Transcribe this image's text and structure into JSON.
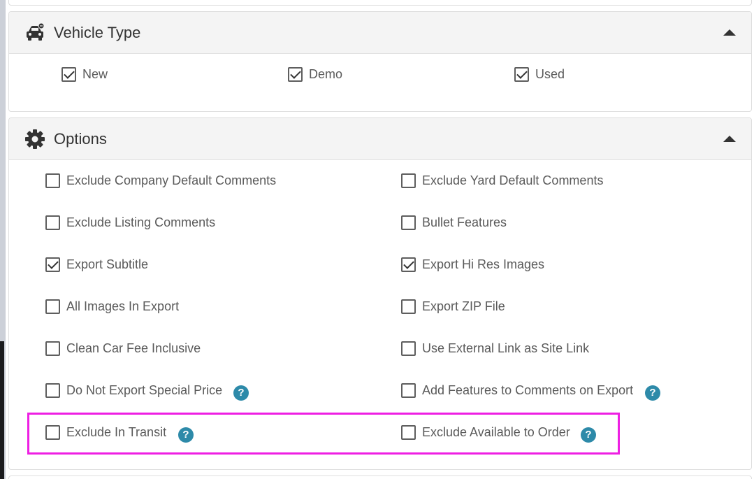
{
  "vehicle_type": {
    "title": "Vehicle Type",
    "icon": "car-icon",
    "items": [
      {
        "label": "New",
        "checked": true
      },
      {
        "label": "Demo",
        "checked": true
      },
      {
        "label": "Used",
        "checked": true
      }
    ]
  },
  "options": {
    "title": "Options",
    "icon": "gear-icon",
    "items": [
      {
        "label": "Exclude Company Default Comments",
        "checked": false
      },
      {
        "label": "Exclude Yard Default Comments",
        "checked": false
      },
      {
        "label": "Exclude Listing Comments",
        "checked": false
      },
      {
        "label": "Bullet Features",
        "checked": false
      },
      {
        "label": "Export Subtitle",
        "checked": true
      },
      {
        "label": "Export Hi Res Images",
        "checked": true
      },
      {
        "label": "All Images In Export",
        "checked": false
      },
      {
        "label": "Export ZIP File",
        "checked": false
      },
      {
        "label": "Clean Car Fee Inclusive",
        "checked": false
      },
      {
        "label": "Use External Link as Site Link",
        "checked": false
      },
      {
        "label": "Do Not Export Special Price",
        "checked": false,
        "help": true
      },
      {
        "label": "Add Features to Comments on Export",
        "checked": false,
        "help": true
      },
      {
        "label": "Exclude In Transit",
        "checked": false,
        "help": true
      },
      {
        "label": "Exclude Available to Order",
        "checked": false,
        "help": true
      }
    ]
  },
  "help_glyph": "?",
  "colors": {
    "help_icon": "#2d8aa9",
    "highlight": "#ee1fe3",
    "header_bg": "#f4f4f4"
  }
}
